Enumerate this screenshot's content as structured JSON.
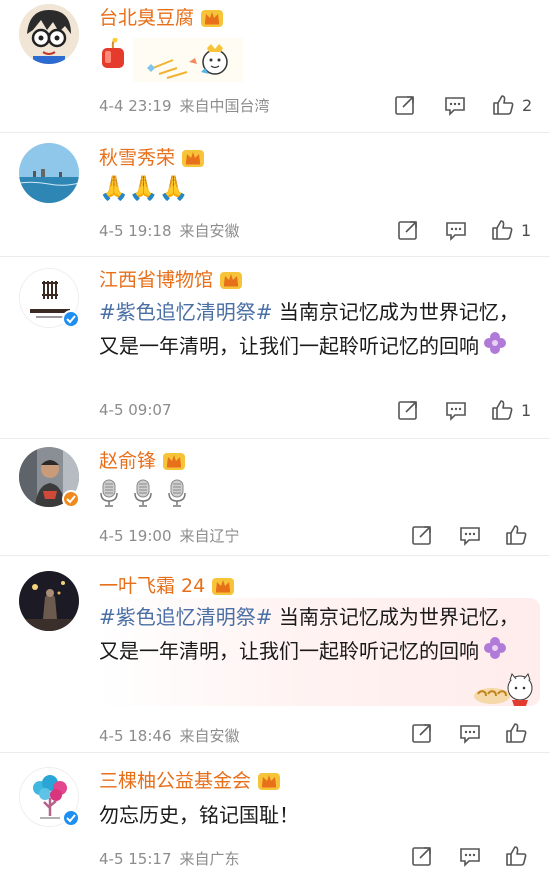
{
  "colors": {
    "name": "#e86f1a",
    "tag": "#4a6fa5",
    "meta": "#8c8c8c",
    "text": "#1a1a1a"
  },
  "icons": {
    "share": "share-icon",
    "comment": "comment-icon",
    "like": "thumbs-up-icon",
    "badge": "crown-badge-icon"
  },
  "comments": [
    {
      "user": "台北臭豆腐",
      "text": "",
      "emoji": "🧨 sticker",
      "date": "4-4 23:19",
      "location": "来自中国台湾",
      "likes": "2"
    },
    {
      "user": "秋雪秀荣",
      "text": "🙏🙏🙏",
      "date": "4-5 19:18",
      "location": "来自安徽",
      "likes": "1"
    },
    {
      "user": "江西省博物馆",
      "tag": "#紫色追忆清明祭#",
      "text": " 当南京记忆成为世界记忆，又是一年清明，让我们一起聆听记忆的回响",
      "date": "4-5 09:07",
      "location": "",
      "likes": "1"
    },
    {
      "user": "赵俞锋",
      "text": "🎙🎙🎙",
      "date": "4-5 19:00",
      "location": "来自辽宁",
      "likes": ""
    },
    {
      "user": "一叶飞霜 24",
      "tag": "#紫色追忆清明祭#",
      "text": " 当南京记忆成为世界记忆，又是一年清明，让我们一起聆听记忆的回响",
      "date": "4-5 18:46",
      "location": "来自安徽",
      "likes": ""
    },
    {
      "user": "三棵柚公益基金会",
      "text": "勿忘历史，铭记国耻！",
      "date": "4-5 15:17",
      "location": "来自广东",
      "likes": ""
    }
  ]
}
